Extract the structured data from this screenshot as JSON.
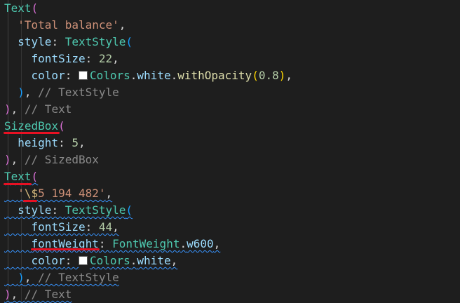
{
  "code_lines": [
    {
      "tokens": [
        {
          "text": "Text",
          "kind": "class"
        },
        {
          "text": "(",
          "kind": "paren-purple"
        }
      ]
    },
    {
      "tokens": [
        {
          "text": "  ",
          "kind": "punct"
        },
        {
          "text": "'Total balance'",
          "kind": "string"
        },
        {
          "text": ",",
          "kind": "punct"
        }
      ]
    },
    {
      "tokens": [
        {
          "text": "  ",
          "kind": "punct"
        },
        {
          "text": "style",
          "kind": "prop"
        },
        {
          "text": ": ",
          "kind": "punct"
        },
        {
          "text": "TextStyle",
          "kind": "class"
        },
        {
          "text": "(",
          "kind": "paren-blue"
        }
      ]
    },
    {
      "tokens": [
        {
          "text": "    ",
          "kind": "punct"
        },
        {
          "text": "fontSize",
          "kind": "prop"
        },
        {
          "text": ": ",
          "kind": "punct"
        },
        {
          "text": "22",
          "kind": "num"
        },
        {
          "text": ",",
          "kind": "punct"
        }
      ]
    },
    {
      "tokens": [
        {
          "text": "    ",
          "kind": "punct"
        },
        {
          "text": "color",
          "kind": "prop"
        },
        {
          "text": ": ",
          "kind": "punct"
        },
        {
          "text": "",
          "kind": "swatch"
        },
        {
          "text": "Colors",
          "kind": "class"
        },
        {
          "text": ".",
          "kind": "punct"
        },
        {
          "text": "white",
          "kind": "prop"
        },
        {
          "text": ".",
          "kind": "punct"
        },
        {
          "text": "withOpacity",
          "kind": "fn"
        },
        {
          "text": "(",
          "kind": "paren-gold"
        },
        {
          "text": "0.8",
          "kind": "num"
        },
        {
          "text": ")",
          "kind": "paren-gold"
        },
        {
          "text": ",",
          "kind": "punct"
        }
      ]
    },
    {
      "tokens": [
        {
          "text": "  ",
          "kind": "punct"
        },
        {
          "text": ")",
          "kind": "paren-blue"
        },
        {
          "text": ", ",
          "kind": "punct"
        },
        {
          "text": "// TextStyle",
          "kind": "comment"
        }
      ]
    },
    {
      "tokens": [
        {
          "text": ")",
          "kind": "paren-purple"
        },
        {
          "text": ", ",
          "kind": "punct"
        },
        {
          "text": "// Text",
          "kind": "comment"
        }
      ]
    },
    {
      "tokens": [
        {
          "text": "SizedBox",
          "kind": "class"
        },
        {
          "text": "(",
          "kind": "paren-purple"
        }
      ]
    },
    {
      "tokens": [
        {
          "text": "  ",
          "kind": "punct"
        },
        {
          "text": "height",
          "kind": "prop"
        },
        {
          "text": ": ",
          "kind": "punct"
        },
        {
          "text": "5",
          "kind": "num"
        },
        {
          "text": ",",
          "kind": "punct"
        }
      ]
    },
    {
      "tokens": [
        {
          "text": ")",
          "kind": "paren-purple"
        },
        {
          "text": ", ",
          "kind": "punct"
        },
        {
          "text": "// SizedBox",
          "kind": "comment"
        }
      ]
    },
    {
      "tokens": [
        {
          "text": "Text",
          "kind": "class"
        },
        {
          "text": "(",
          "kind": "paren-purple"
        }
      ]
    },
    {
      "tokens": [
        {
          "text": "  ",
          "kind": "punct"
        },
        {
          "text": "'",
          "kind": "string"
        },
        {
          "text": "\\$",
          "kind": "escape"
        },
        {
          "text": "5 194 482'",
          "kind": "string"
        },
        {
          "text": ",",
          "kind": "punct"
        }
      ]
    },
    {
      "tokens": [
        {
          "text": "  ",
          "kind": "punct"
        },
        {
          "text": "style",
          "kind": "prop"
        },
        {
          "text": ": ",
          "kind": "punct"
        },
        {
          "text": "TextStyle",
          "kind": "class"
        },
        {
          "text": "(",
          "kind": "paren-blue"
        }
      ]
    },
    {
      "tokens": [
        {
          "text": "    ",
          "kind": "punct"
        },
        {
          "text": "fontSize",
          "kind": "prop"
        },
        {
          "text": ": ",
          "kind": "punct"
        },
        {
          "text": "44",
          "kind": "num"
        },
        {
          "text": ",",
          "kind": "punct"
        }
      ]
    },
    {
      "tokens": [
        {
          "text": "    ",
          "kind": "punct"
        },
        {
          "text": "fontWeight",
          "kind": "prop"
        },
        {
          "text": ": ",
          "kind": "punct"
        },
        {
          "text": "FontWeight",
          "kind": "class"
        },
        {
          "text": ".",
          "kind": "punct"
        },
        {
          "text": "w600",
          "kind": "prop"
        },
        {
          "text": ",",
          "kind": "punct"
        }
      ]
    },
    {
      "tokens": [
        {
          "text": "    ",
          "kind": "punct"
        },
        {
          "text": "color",
          "kind": "prop"
        },
        {
          "text": ": ",
          "kind": "punct"
        },
        {
          "text": "",
          "kind": "swatch"
        },
        {
          "text": "Colors",
          "kind": "class"
        },
        {
          "text": ".",
          "kind": "punct"
        },
        {
          "text": "white",
          "kind": "prop"
        },
        {
          "text": ",",
          "kind": "punct"
        }
      ]
    },
    {
      "tokens": [
        {
          "text": "  ",
          "kind": "punct"
        },
        {
          "text": ")",
          "kind": "paren-blue"
        },
        {
          "text": ", ",
          "kind": "punct"
        },
        {
          "text": "// TextStyle",
          "kind": "comment"
        }
      ]
    },
    {
      "tokens": [
        {
          "text": ")",
          "kind": "paren-purple"
        },
        {
          "text": ", ",
          "kind": "punct"
        },
        {
          "text": "// Text",
          "kind": "comment"
        }
      ]
    }
  ],
  "swatch_color": "#ffffff",
  "annotation_color": "#e81123",
  "squiggle_color": "#3794ff"
}
